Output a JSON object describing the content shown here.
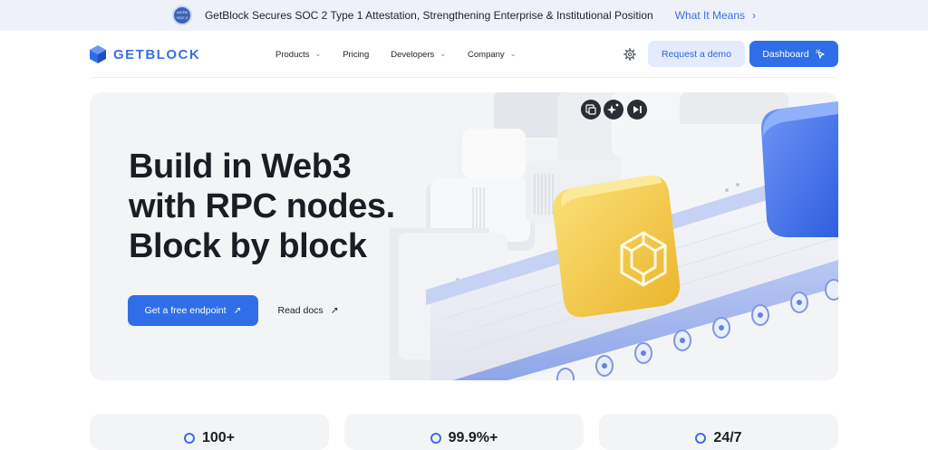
{
  "announcement": {
    "badge_line1": "AICPA",
    "badge_line2": "SOC 2",
    "message": "GetBlock Secures SOC 2 Type 1 Attestation, Strengthening Enterprise & Institutional Position",
    "link_label": "What It Means",
    "link_icon": "chevron-right-icon"
  },
  "header": {
    "logo_text": "GETBLOCK",
    "nav": [
      {
        "label": "Products",
        "has_dropdown": true
      },
      {
        "label": "Pricing",
        "has_dropdown": false
      },
      {
        "label": "Developers",
        "has_dropdown": true
      },
      {
        "label": "Company",
        "has_dropdown": true
      }
    ],
    "settings_icon": "gear-icon",
    "request_demo_label": "Request a demo",
    "dashboard_label": "Dashboard"
  },
  "hero": {
    "title_lines": [
      "Build in Web3",
      "with RPC nodes.",
      "Block by block"
    ],
    "primary_cta": "Get a free endpoint",
    "secondary_cta": "Read docs",
    "media_controls": [
      "gallery-icon",
      "sparkle-icon",
      "play-icon"
    ]
  },
  "stats": [
    {
      "value": "100+"
    },
    {
      "value": "99.9%+"
    },
    {
      "value": "24/7"
    }
  ],
  "colors": {
    "brand_blue": "#2f6ee7",
    "announcement_bg": "#eef1f8",
    "hero_bg": "#f3f4f6",
    "yellow_cube": "#f3c93a"
  }
}
